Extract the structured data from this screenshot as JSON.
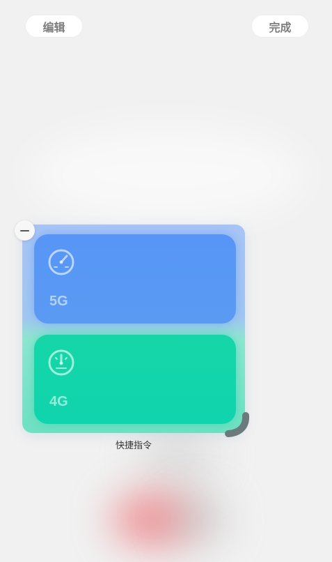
{
  "header": {
    "edit_label": "编辑",
    "done_label": "完成"
  },
  "widget": {
    "caption": "快捷指令",
    "tiles": [
      {
        "label": "5G",
        "icon": "speedometer-icon",
        "color": "#5796f6"
      },
      {
        "label": "4G",
        "icon": "speedometer-icon",
        "color": "#16d6a8"
      }
    ]
  },
  "colors": {
    "background": "#f1f1f1",
    "button_bg": "#ffffff",
    "button_text": "#7d7d7d",
    "tile_5g": "#5796f6",
    "tile_4g": "#16d6a8",
    "resize_handle": "#6b7b7d"
  }
}
